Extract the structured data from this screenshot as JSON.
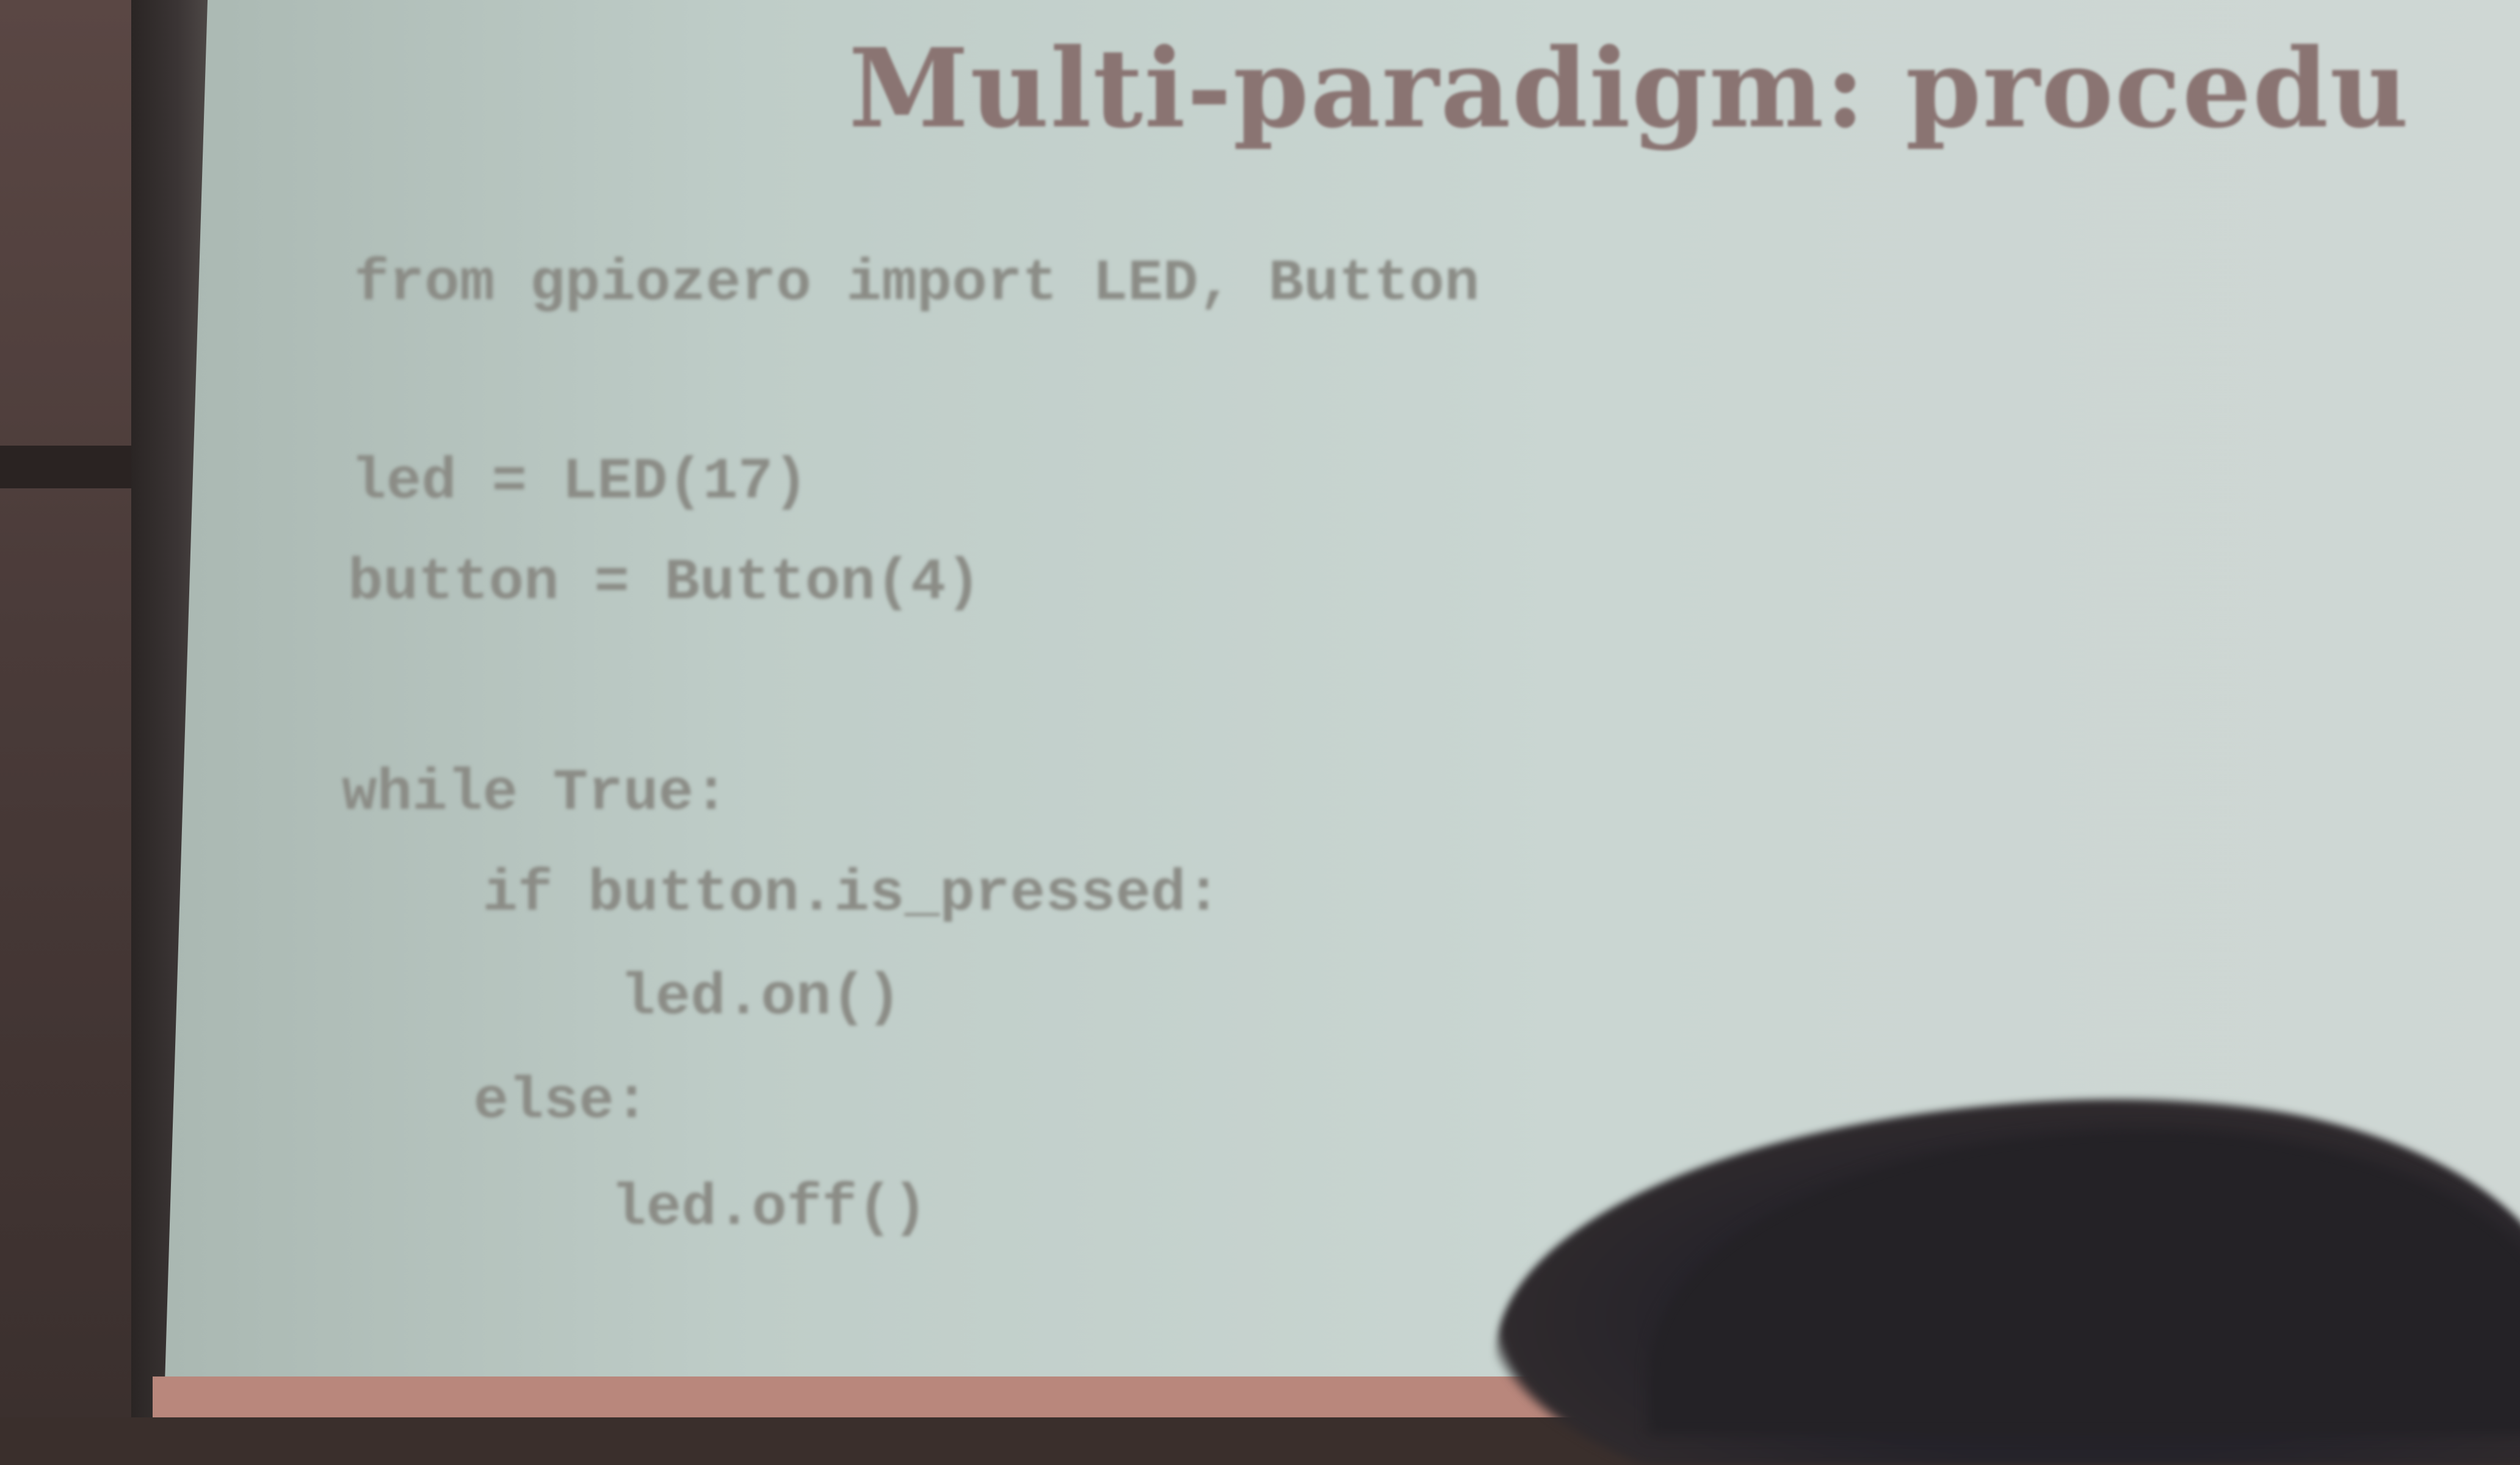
{
  "slide": {
    "title": "Multi-paradigm: procedu",
    "code_lines": [
      "from gpiozero import LED, Button",
      "led = LED(17)",
      "button = Button(4)",
      "while True:",
      "    if button.is_pressed:",
      "        led.on()",
      "    else:",
      "        led.off()"
    ]
  }
}
